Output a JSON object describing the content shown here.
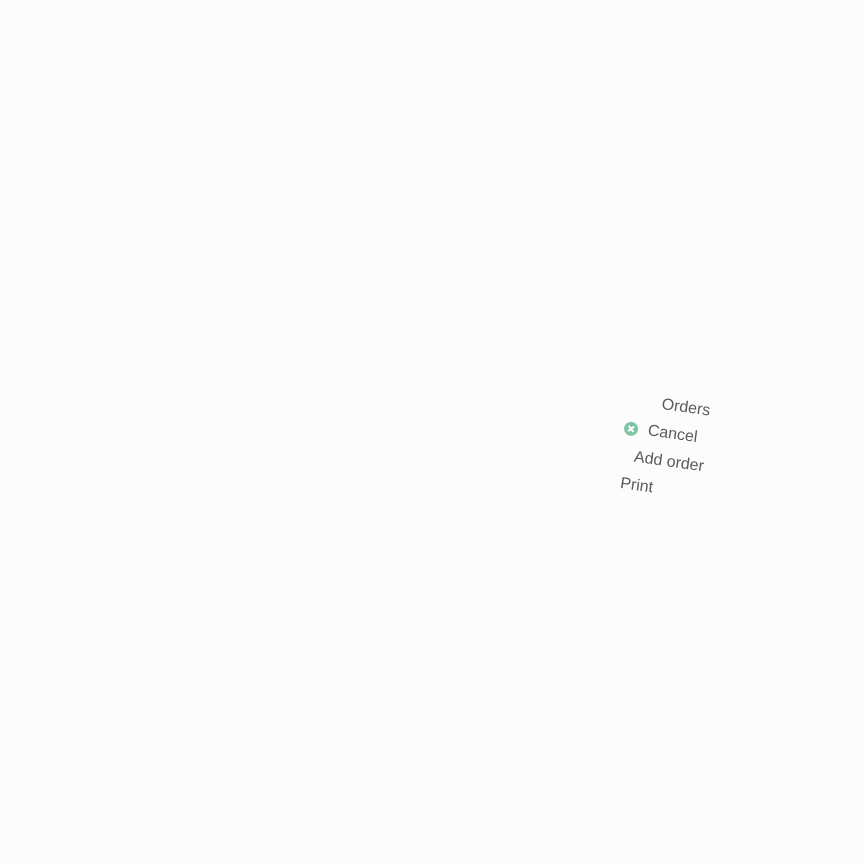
{
  "menu": {
    "items": [
      {
        "label": "Orders"
      },
      {
        "label": "Cancel",
        "icon": "close-circle-icon"
      },
      {
        "label": "Add order"
      },
      {
        "label": "Print"
      }
    ]
  },
  "colors": {
    "background": "#fcfcfc",
    "text": "#5a5a5a",
    "accent": "#7dc7a6"
  }
}
